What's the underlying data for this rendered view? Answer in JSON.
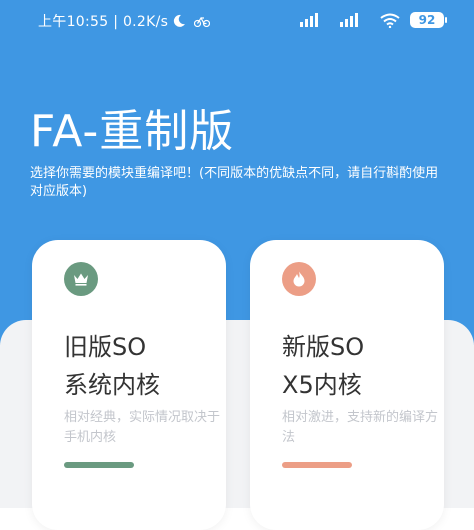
{
  "status_bar": {
    "time_speed": "上午10:55 | 0.2K/s",
    "battery": "92"
  },
  "header": {
    "title": "FA-重制版",
    "description": "选择你需要的模块重编译吧！(不同版本的优缺点不同，请自行斟酌使用对应版本)"
  },
  "cards": [
    {
      "title": "旧版SO\n系统内核",
      "subtitle": "相对经典，实际情况取决于手机内核",
      "icon": "crown-icon",
      "accent": "#6a9a80"
    },
    {
      "title": "新版SO\nX5内核",
      "subtitle": "相对激进，支持新的编译方法",
      "icon": "flame-icon",
      "accent": "#ec9e86"
    }
  ],
  "colors": {
    "primary": "#3f97e3",
    "background": "#f2f3f5"
  }
}
